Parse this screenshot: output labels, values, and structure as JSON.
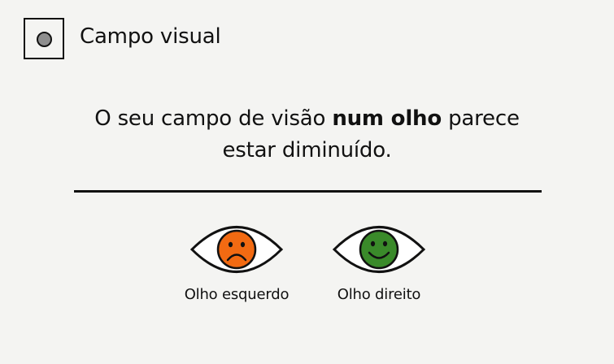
{
  "header": {
    "icon": "radio-dot-icon",
    "title": "Campo visual"
  },
  "message": {
    "part1": "O seu campo de visão ",
    "emphasis": "num olho",
    "part2": " parece",
    "line2": "estar diminuído."
  },
  "eyes": [
    {
      "label": "Olho esquerdo",
      "status": "sad",
      "icon": "sad-face-icon",
      "color": "#f26a12"
    },
    {
      "label": "Olho direito",
      "status": "happy",
      "icon": "happy-face-icon",
      "color": "#3a8a2a"
    }
  ],
  "colors": {
    "background": "#f4f4f2",
    "text": "#111111",
    "dot": "#8e8e8e"
  }
}
